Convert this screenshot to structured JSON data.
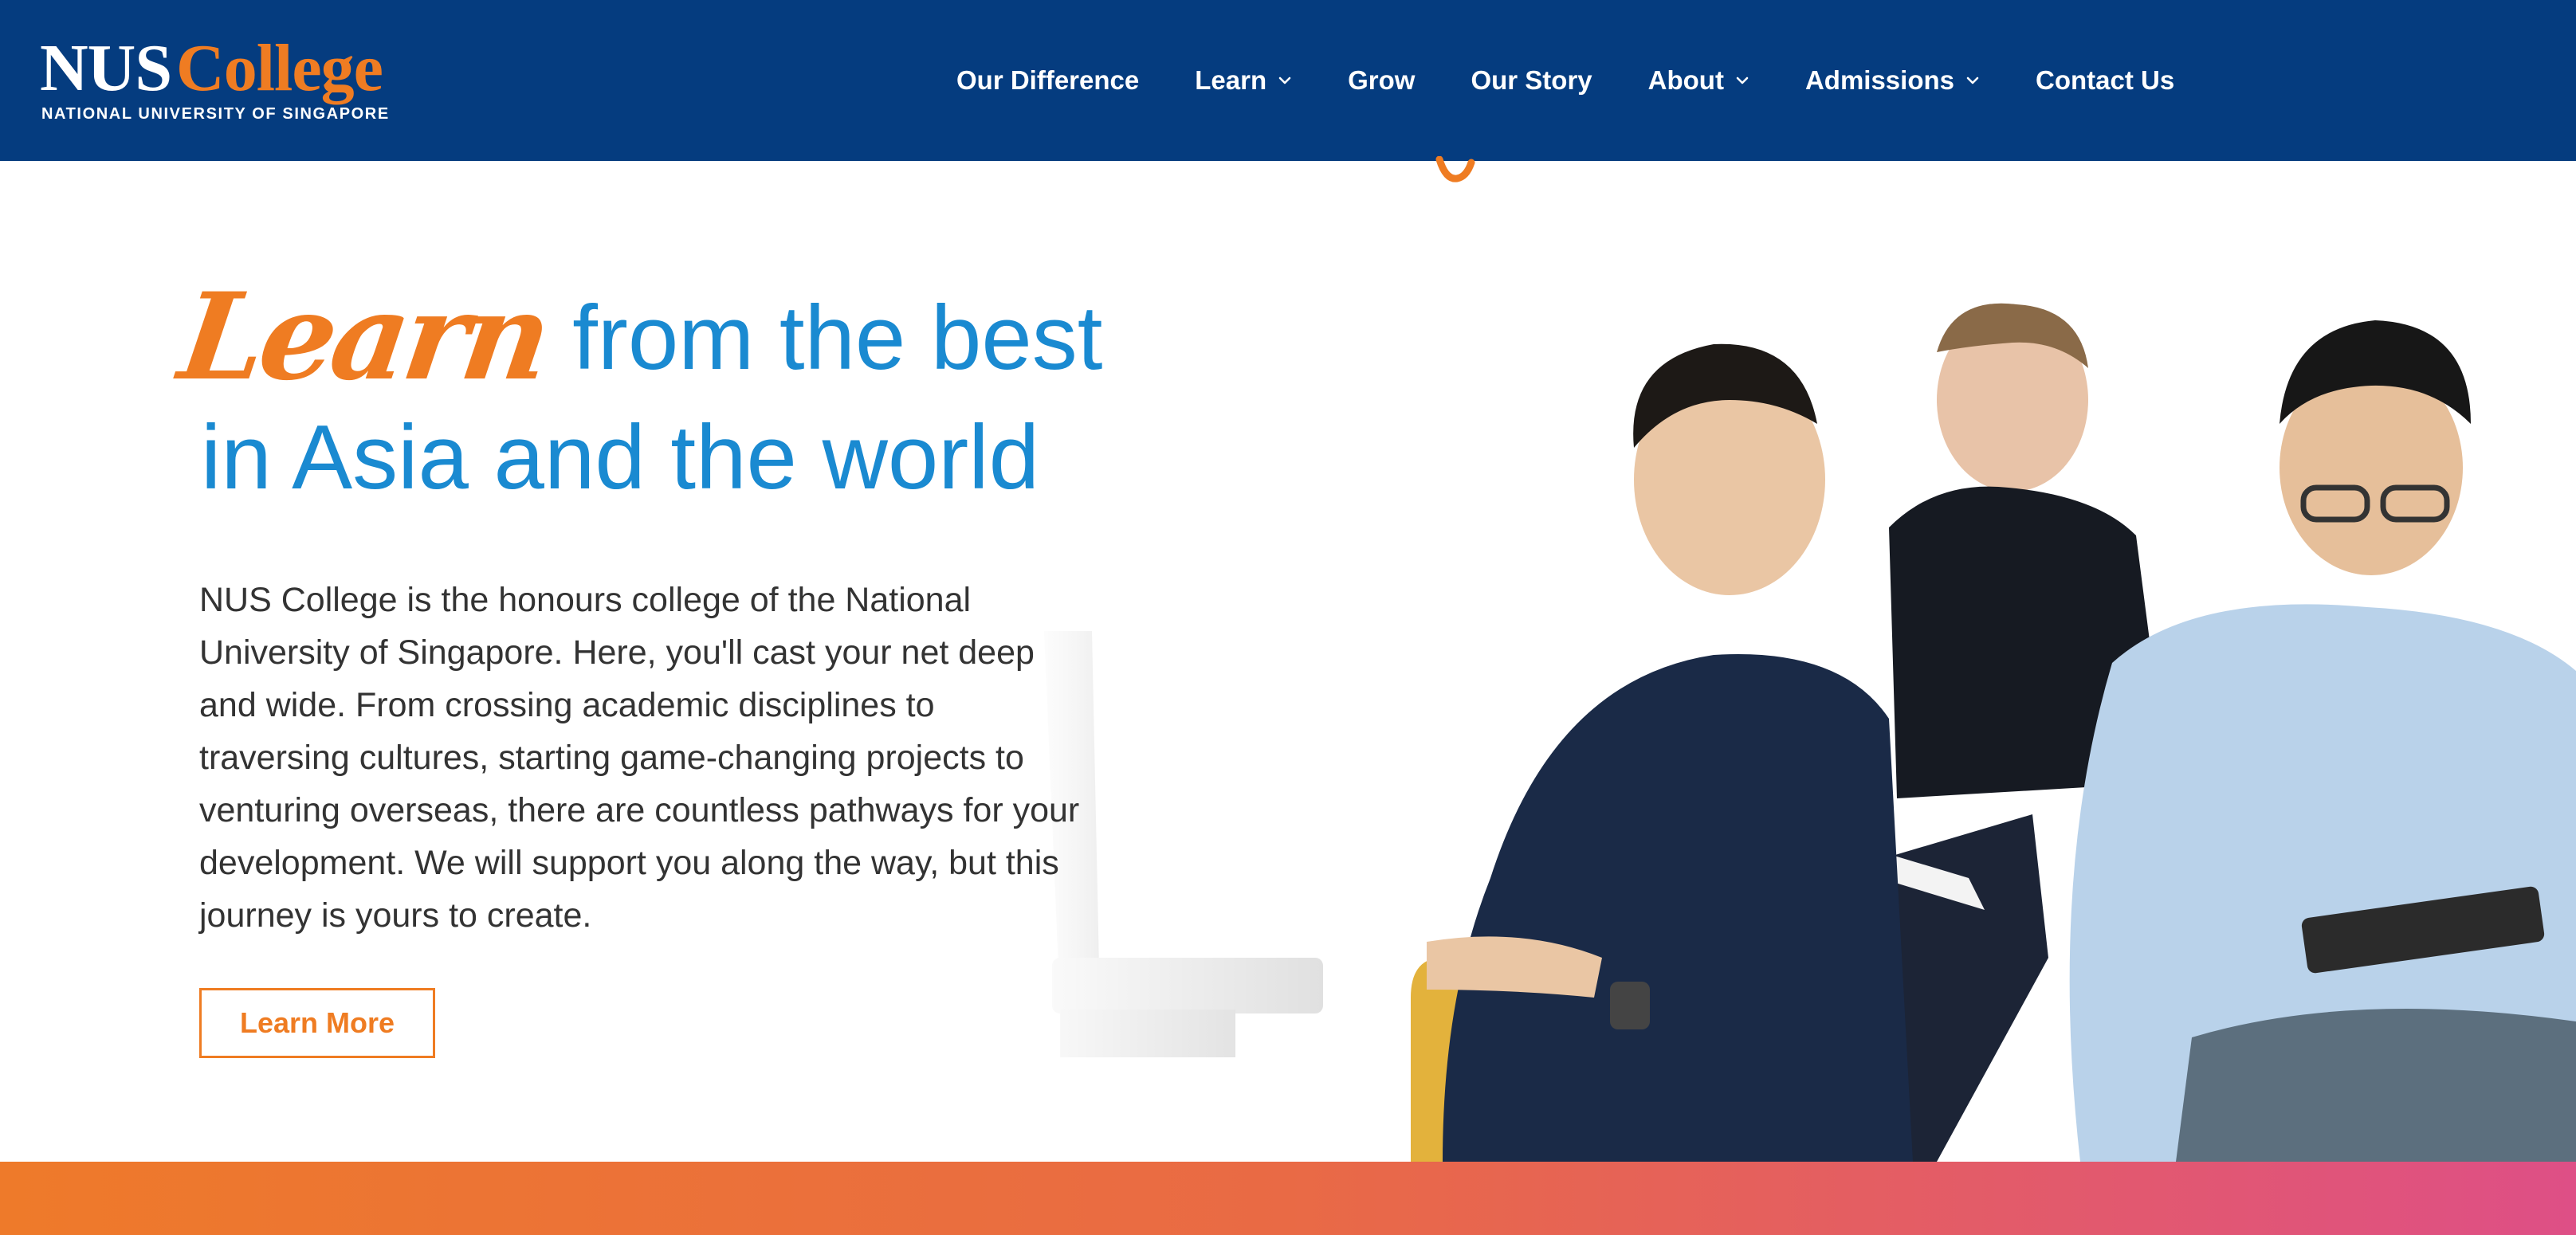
{
  "header": {
    "logo": {
      "primary": "NUS",
      "secondary": "College",
      "subtitle": "NATIONAL UNIVERSITY OF SINGAPORE"
    },
    "nav": [
      {
        "label": "Our Difference",
        "dropdown": false
      },
      {
        "label": "Learn",
        "dropdown": true
      },
      {
        "label": "Grow",
        "dropdown": false
      },
      {
        "label": "Our Story",
        "dropdown": false
      },
      {
        "label": "About",
        "dropdown": true
      },
      {
        "label": "Admissions",
        "dropdown": true
      },
      {
        "label": "Contact Us",
        "dropdown": false
      }
    ]
  },
  "hero": {
    "heading_script": "Learn",
    "heading_line1": "from the best",
    "heading_line2": "in Asia and the world",
    "body": "NUS College is the honours college of the National University of Singapore. Here, you'll cast your net deep and wide. From crossing academic disciplines to traversing cultures, starting game-changing projects to venturing overseas, there are countless pathways for your development. We will support you along the way, but this journey is yours to create.",
    "cta_label": "Learn More"
  },
  "colors": {
    "header_bg": "#053c7f",
    "brand_orange": "#ef7c22",
    "heading_blue": "#1a8ad1",
    "band_gradient_start": "#ee7a2a",
    "band_gradient_end": "#de4f86"
  },
  "icons": {
    "dropdown": "chevron-down-icon"
  }
}
